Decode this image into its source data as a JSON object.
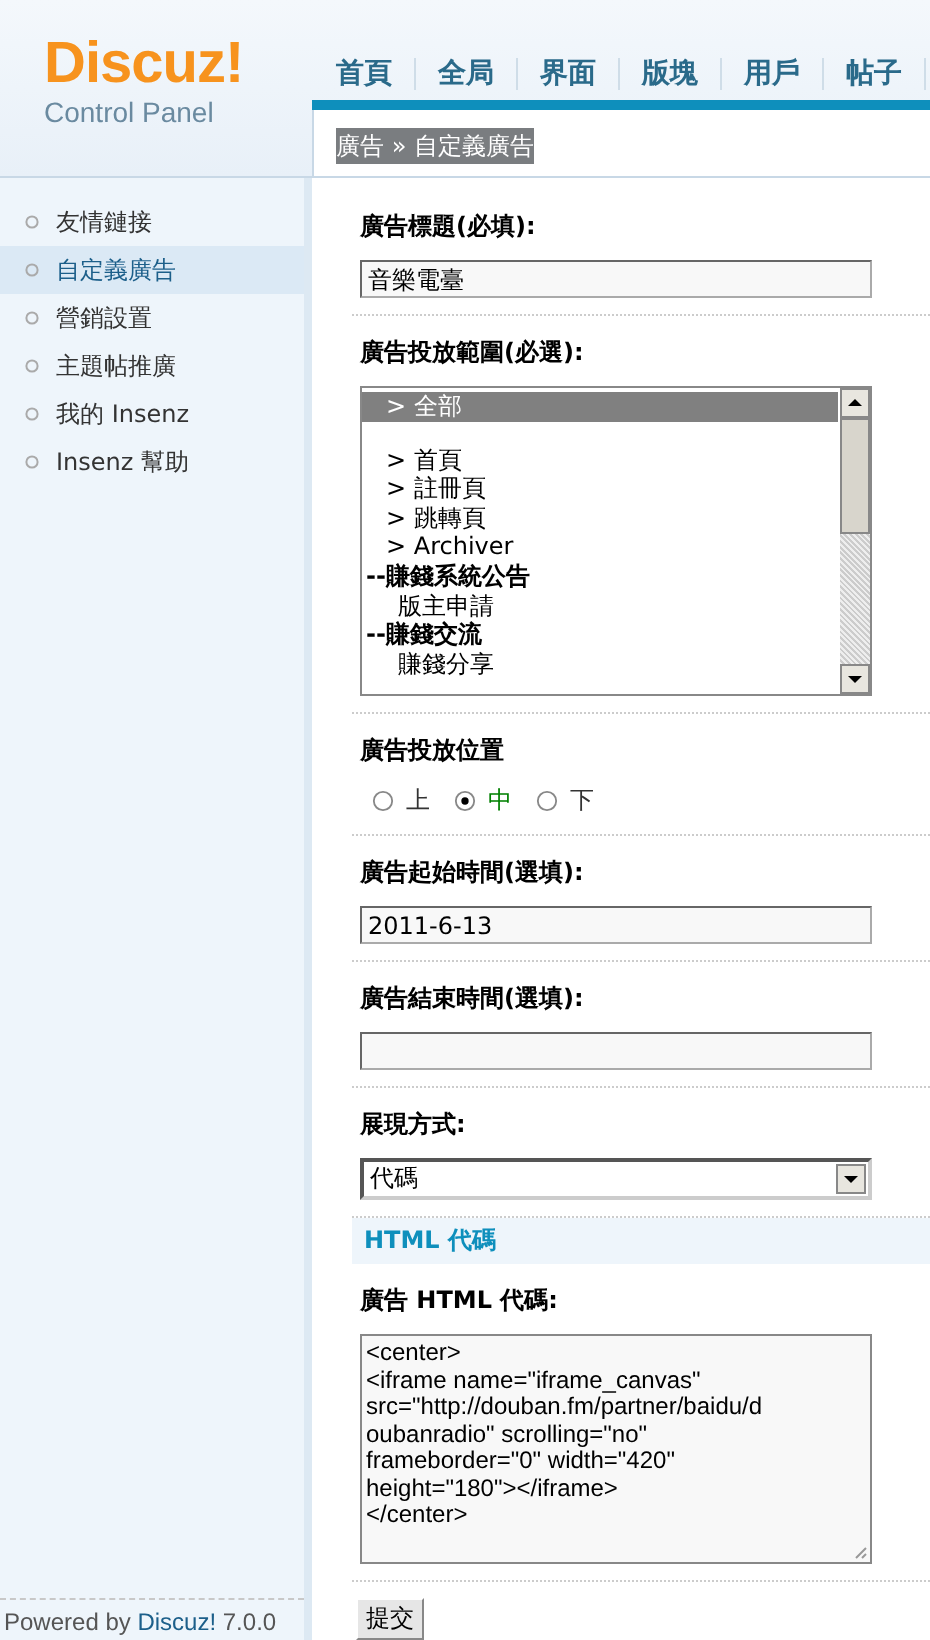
{
  "logo": {
    "brand": "Discuz!",
    "subtitle": "Control Panel"
  },
  "nav": [
    {
      "label": "首頁",
      "selected": false
    },
    {
      "label": "全局",
      "selected": false
    },
    {
      "label": "界面",
      "selected": false
    },
    {
      "label": "版塊",
      "selected": false
    },
    {
      "label": "用戶",
      "selected": false
    },
    {
      "label": "帖子",
      "selected": false
    }
  ],
  "breadcrumb": "廣告 » 自定義廣告",
  "sidebar": {
    "items": [
      {
        "label": "友情鏈接",
        "selected": false
      },
      {
        "label": "自定義廣告",
        "selected": true
      },
      {
        "label": "營銷設置",
        "selected": false
      },
      {
        "label": "主題帖推廣",
        "selected": false
      },
      {
        "label": "我的 Insenz",
        "selected": false
      },
      {
        "label": "Insenz 幫助",
        "selected": false
      }
    ],
    "footer": {
      "prefix": "Powered by",
      "link": "Discuz!",
      "suffix": "7.0.0"
    }
  },
  "form": [
    {
      "kind": "text",
      "label": "廣告標題(必填):",
      "value": "音樂電臺"
    },
    {
      "kind": "list",
      "label": "廣告投放範圍(必選):",
      "options": [
        {
          "kind": "option",
          "label": "> 全部",
          "selected": true
        },
        {
          "kind": "blank"
        },
        {
          "kind": "option",
          "label": "> 首頁",
          "selected": false
        },
        {
          "kind": "option",
          "label": "> 註冊頁",
          "selected": false
        },
        {
          "kind": "option",
          "label": "> 跳轉頁",
          "selected": false
        },
        {
          "kind": "option",
          "label": "> Archiver",
          "selected": false
        },
        {
          "kind": "group",
          "label": "--賺錢系統公告",
          "selected": false
        },
        {
          "kind": "sub",
          "label": "版主申請",
          "selected": false
        },
        {
          "kind": "group",
          "label": "--賺錢交流",
          "selected": false
        },
        {
          "kind": "sub",
          "label": "賺錢分享",
          "selected": false
        }
      ]
    },
    {
      "kind": "radio",
      "label": "廣告投放位置",
      "options": [
        {
          "label": "上",
          "selected": false
        },
        {
          "label": "中",
          "selected": true
        },
        {
          "label": "下",
          "selected": false
        }
      ]
    },
    {
      "kind": "text",
      "label": "廣告起始時間(選填):",
      "value": "2011-6-13"
    },
    {
      "kind": "text",
      "label": "廣告結束時間(選填):"
    },
    {
      "kind": "select",
      "label": "展現方式:",
      "value": "代碼"
    },
    {
      "kind": "section",
      "label": "HTML 代碼"
    },
    {
      "kind": "code",
      "label": "廣告 HTML 代碼:",
      "lines": [
        "<center>",
        "<iframe name=\"iframe_canvas\"",
        "src=\"http://douban.fm/partner/baidu/d",
        "oubanradio\" scrolling=\"no\"",
        "frameborder=\"0\" width=\"420\"",
        "height=\"180\"></iframe>",
        "</center>"
      ]
    }
  ],
  "submit": "提交"
}
